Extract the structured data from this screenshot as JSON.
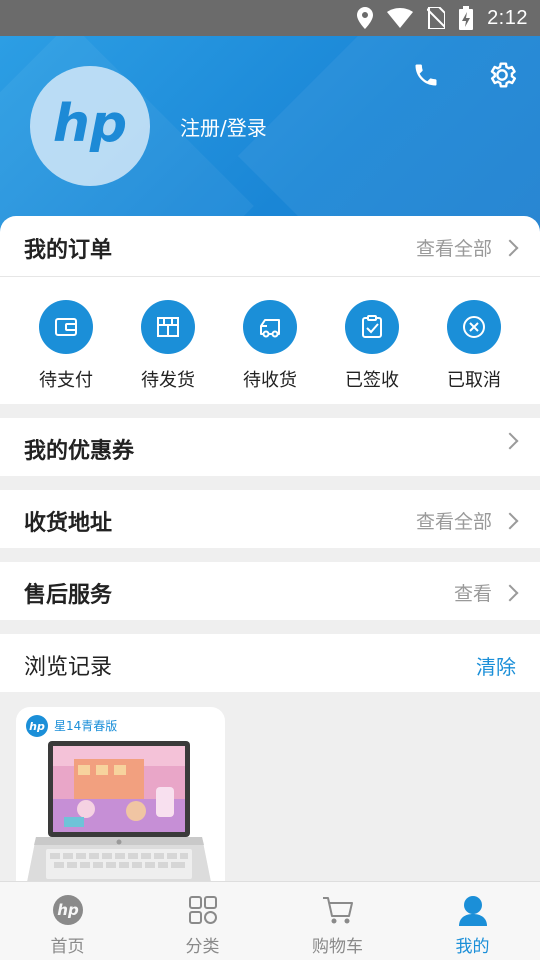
{
  "status_bar": {
    "time": "2:12"
  },
  "header": {
    "login_label": "注册/登录"
  },
  "orders": {
    "title": "我的订单",
    "view_all": "查看全部",
    "items": [
      {
        "label": "待支付",
        "icon": "wallet-icon"
      },
      {
        "label": "待发货",
        "icon": "package-icon"
      },
      {
        "label": "待收货",
        "icon": "truck-icon"
      },
      {
        "label": "已签收",
        "icon": "clipboard-check-icon"
      },
      {
        "label": "已取消",
        "icon": "cancel-circle-icon"
      }
    ]
  },
  "coupons": {
    "title": "我的优惠券"
  },
  "address": {
    "title": "收货地址",
    "view_all": "查看全部"
  },
  "after_sales": {
    "title": "售后服务",
    "view": "查看"
  },
  "history": {
    "title": "浏览记录",
    "clear": "清除",
    "items": [
      {
        "name": "星14青春版"
      }
    ]
  },
  "tabbar": {
    "items": [
      {
        "label": "首页",
        "icon": "hp-logo-icon"
      },
      {
        "label": "分类",
        "icon": "grid-icon"
      },
      {
        "label": "购物车",
        "icon": "cart-icon"
      },
      {
        "label": "我的",
        "icon": "person-icon",
        "active": true
      }
    ]
  },
  "colors": {
    "accent": "#1b8fd8",
    "header_bg": "#2590e0",
    "status_bar": "#6b6b6b"
  }
}
